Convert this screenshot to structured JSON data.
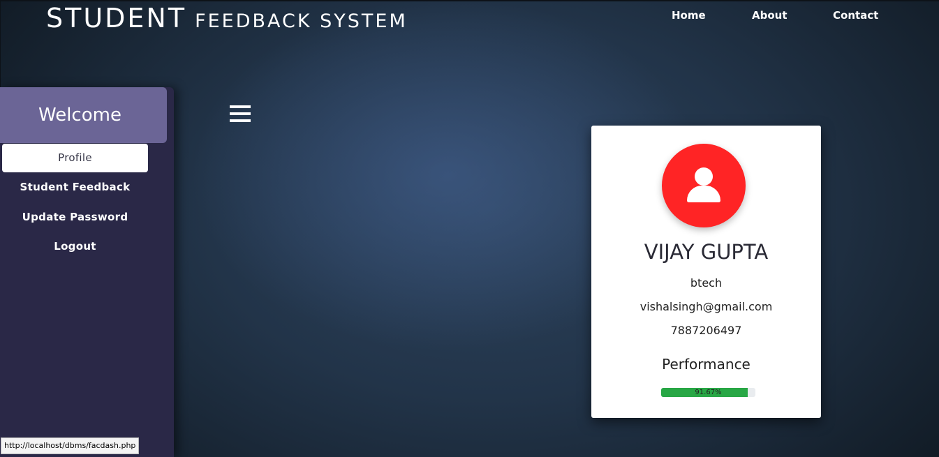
{
  "header": {
    "brand_main": "STUDENT",
    "brand_sub": "FEEDBACK SYSTEM",
    "nav": [
      {
        "label": "Home"
      },
      {
        "label": "About"
      },
      {
        "label": "Contact"
      }
    ]
  },
  "sidebar": {
    "welcome": "Welcome",
    "items": [
      {
        "label": "Profile",
        "active": true
      },
      {
        "label": "Student Feedback",
        "active": false
      },
      {
        "label": "Update Password",
        "active": false
      },
      {
        "label": "Logout",
        "active": false
      }
    ]
  },
  "menu_toggle_icon": "hamburger-menu-icon",
  "profile": {
    "avatar_icon": "user-avatar-icon",
    "avatar_color": "#ff2425",
    "name": "VIJAY GUPTA",
    "course": "btech",
    "email": "vishalsingh@gmail.com",
    "phone": "7887206497",
    "performance_title": "Performance",
    "performance_value": 91.67,
    "performance_label": "91.67%",
    "progress_color": "#28a745"
  },
  "status_bar": {
    "url": "http://localhost/dbms/facdash.php"
  }
}
